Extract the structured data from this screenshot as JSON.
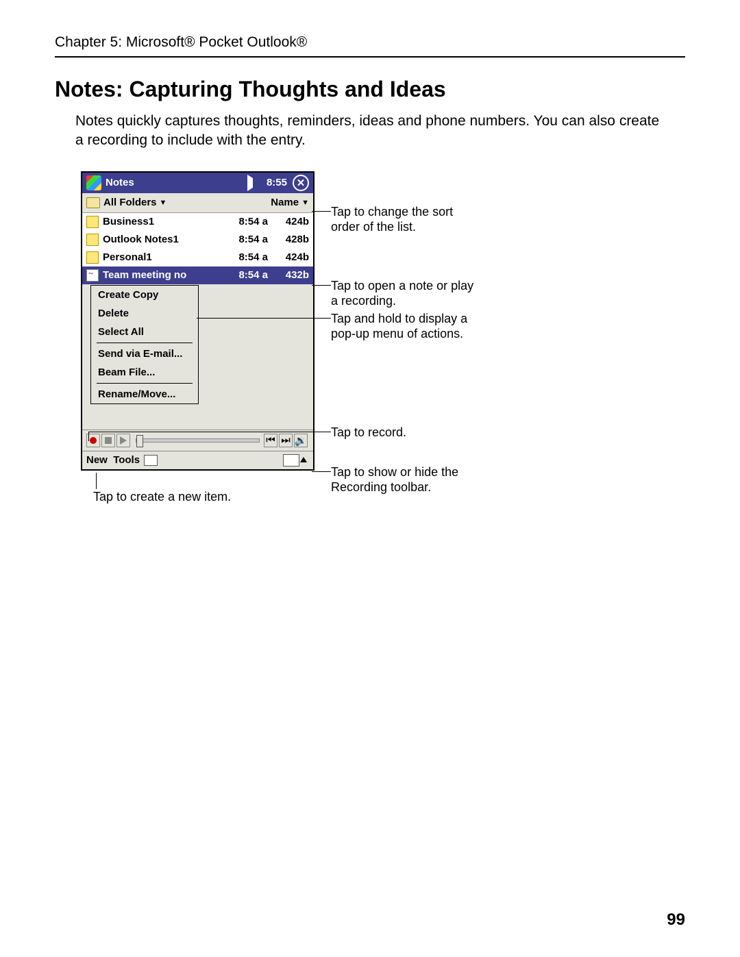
{
  "chapter": "Chapter 5: Microsoft® Pocket Outlook®",
  "heading": "Notes: Capturing Thoughts and Ideas",
  "intro": "Notes quickly captures thoughts, reminders, ideas and phone numbers. You can also create a recording to include with the entry.",
  "page_number": "99",
  "device": {
    "title": "Notes",
    "time": "8:55",
    "folder_dropdown": "All Folders",
    "sort_dropdown": "Name",
    "rows": [
      {
        "name": "Business1",
        "time": "8:54 a",
        "size": "424b",
        "icon": "note"
      },
      {
        "name": "Outlook Notes1",
        "time": "8:54 a",
        "size": "428b",
        "icon": "note"
      },
      {
        "name": "Personal1",
        "time": "8:54 a",
        "size": "424b",
        "icon": "note"
      },
      {
        "name": "Team meeting no",
        "time": "8:54 a",
        "size": "432b",
        "icon": "rec",
        "selected": true
      }
    ],
    "popup": {
      "group1": [
        "Create Copy",
        "Delete",
        "Select All"
      ],
      "group2": [
        "Send via E-mail...",
        "Beam File..."
      ],
      "group3": [
        "Rename/Move..."
      ]
    },
    "menubar": {
      "new": "New",
      "tools": "Tools"
    }
  },
  "callouts": {
    "sort": "Tap to change the sort order of the list.",
    "open": "Tap to open a note or play a recording.",
    "hold": "Tap and hold to display a pop-up menu of actions.",
    "record": "Tap to record.",
    "show_toolbar": "Tap to show or hide the Recording toolbar.",
    "new_item": "Tap to create a new item."
  }
}
